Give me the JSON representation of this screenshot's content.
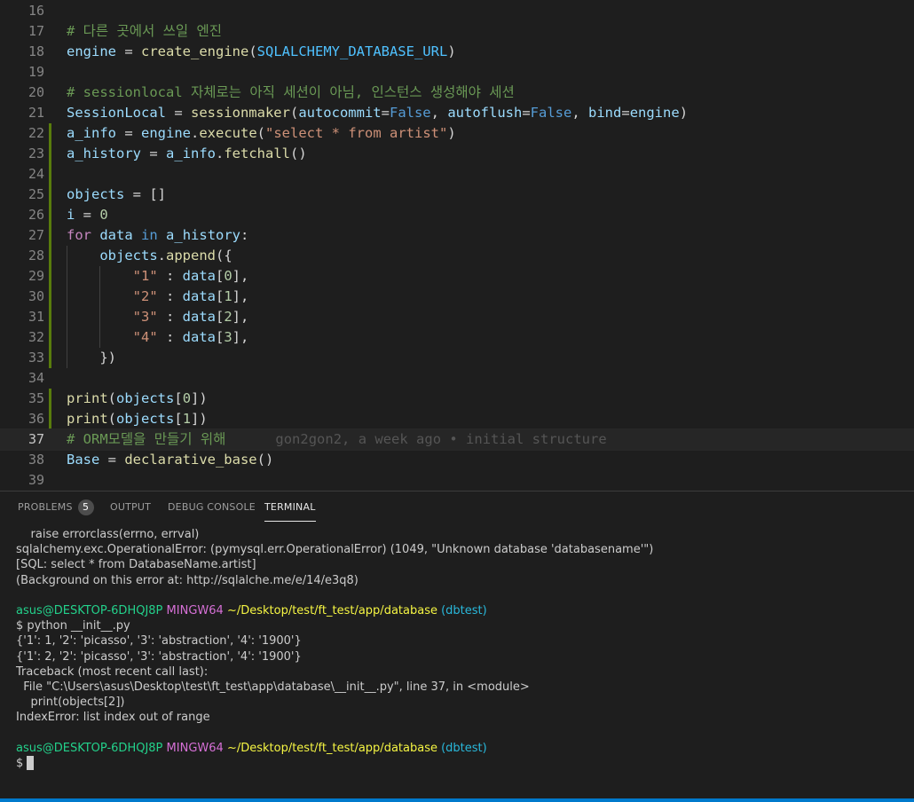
{
  "editor": {
    "lines": [
      {
        "n": "16",
        "tokens": []
      },
      {
        "n": "17",
        "tokens": [
          {
            "t": "# 다른 곳에서 쓰일 엔진",
            "c": "comment"
          }
        ]
      },
      {
        "n": "18",
        "tokens": [
          {
            "t": "engine",
            "c": "var"
          },
          {
            "t": " = ",
            "c": "op"
          },
          {
            "t": "create_engine",
            "c": "fn"
          },
          {
            "t": "(",
            "c": "op"
          },
          {
            "t": "SQLALCHEMY_DATABASE_URL",
            "c": "const"
          },
          {
            "t": ")",
            "c": "op"
          }
        ]
      },
      {
        "n": "19",
        "tokens": []
      },
      {
        "n": "20",
        "tokens": [
          {
            "t": "# sessionlocal 자체로는 아직 세션이 아님, 인스턴스 생성해야 세션",
            "c": "comment"
          }
        ]
      },
      {
        "n": "21",
        "tokens": [
          {
            "t": "SessionLocal",
            "c": "var"
          },
          {
            "t": " = ",
            "c": "op"
          },
          {
            "t": "sessionmaker",
            "c": "fn"
          },
          {
            "t": "(",
            "c": "op"
          },
          {
            "t": "autocommit",
            "c": "var"
          },
          {
            "t": "=",
            "c": "op"
          },
          {
            "t": "False",
            "c": "kw"
          },
          {
            "t": ", ",
            "c": "op"
          },
          {
            "t": "autoflush",
            "c": "var"
          },
          {
            "t": "=",
            "c": "op"
          },
          {
            "t": "False",
            "c": "kw"
          },
          {
            "t": ", ",
            "c": "op"
          },
          {
            "t": "bind",
            "c": "var"
          },
          {
            "t": "=",
            "c": "op"
          },
          {
            "t": "engine",
            "c": "var"
          },
          {
            "t": ")",
            "c": "op"
          }
        ]
      },
      {
        "n": "22",
        "mod": true,
        "tokens": [
          {
            "t": "a_info",
            "c": "var"
          },
          {
            "t": " = ",
            "c": "op"
          },
          {
            "t": "engine",
            "c": "var"
          },
          {
            "t": ".",
            "c": "op"
          },
          {
            "t": "execute",
            "c": "fn"
          },
          {
            "t": "(",
            "c": "op"
          },
          {
            "t": "\"select * from artist\"",
            "c": "str"
          },
          {
            "t": ")",
            "c": "op"
          }
        ]
      },
      {
        "n": "23",
        "mod": true,
        "tokens": [
          {
            "t": "a_history",
            "c": "var"
          },
          {
            "t": " = ",
            "c": "op"
          },
          {
            "t": "a_info",
            "c": "var"
          },
          {
            "t": ".",
            "c": "op"
          },
          {
            "t": "fetchall",
            "c": "fn"
          },
          {
            "t": "()",
            "c": "op"
          }
        ]
      },
      {
        "n": "24",
        "mod": true,
        "tokens": []
      },
      {
        "n": "25",
        "mod": true,
        "tokens": [
          {
            "t": "objects",
            "c": "var"
          },
          {
            "t": " = []",
            "c": "op"
          }
        ]
      },
      {
        "n": "26",
        "mod": true,
        "tokens": [
          {
            "t": "i",
            "c": "var"
          },
          {
            "t": " = ",
            "c": "op"
          },
          {
            "t": "0",
            "c": "num"
          }
        ]
      },
      {
        "n": "27",
        "mod": true,
        "tokens": [
          {
            "t": "for",
            "c": "ctrl"
          },
          {
            "t": " ",
            "c": "op"
          },
          {
            "t": "data",
            "c": "var"
          },
          {
            "t": " ",
            "c": "op"
          },
          {
            "t": "in",
            "c": "kw"
          },
          {
            "t": " ",
            "c": "op"
          },
          {
            "t": "a_history",
            "c": "var"
          },
          {
            "t": ":",
            "c": "op"
          }
        ]
      },
      {
        "n": "28",
        "mod": true,
        "guides": [
          1
        ],
        "tokens": [
          {
            "t": "    ",
            "c": "op"
          },
          {
            "t": "objects",
            "c": "var"
          },
          {
            "t": ".",
            "c": "op"
          },
          {
            "t": "append",
            "c": "fn"
          },
          {
            "t": "({",
            "c": "op"
          }
        ]
      },
      {
        "n": "29",
        "mod": true,
        "guides": [
          1,
          2
        ],
        "tokens": [
          {
            "t": "        ",
            "c": "op"
          },
          {
            "t": "\"1\"",
            "c": "str"
          },
          {
            "t": " : ",
            "c": "op"
          },
          {
            "t": "data",
            "c": "var"
          },
          {
            "t": "[",
            "c": "op"
          },
          {
            "t": "0",
            "c": "num"
          },
          {
            "t": "],",
            "c": "op"
          }
        ]
      },
      {
        "n": "30",
        "mod": true,
        "guides": [
          1,
          2
        ],
        "tokens": [
          {
            "t": "        ",
            "c": "op"
          },
          {
            "t": "\"2\"",
            "c": "str"
          },
          {
            "t": " : ",
            "c": "op"
          },
          {
            "t": "data",
            "c": "var"
          },
          {
            "t": "[",
            "c": "op"
          },
          {
            "t": "1",
            "c": "num"
          },
          {
            "t": "],",
            "c": "op"
          }
        ]
      },
      {
        "n": "31",
        "mod": true,
        "guides": [
          1,
          2
        ],
        "tokens": [
          {
            "t": "        ",
            "c": "op"
          },
          {
            "t": "\"3\"",
            "c": "str"
          },
          {
            "t": " : ",
            "c": "op"
          },
          {
            "t": "data",
            "c": "var"
          },
          {
            "t": "[",
            "c": "op"
          },
          {
            "t": "2",
            "c": "num"
          },
          {
            "t": "],",
            "c": "op"
          }
        ]
      },
      {
        "n": "32",
        "mod": true,
        "guides": [
          1,
          2
        ],
        "tokens": [
          {
            "t": "        ",
            "c": "op"
          },
          {
            "t": "\"4\"",
            "c": "str"
          },
          {
            "t": " : ",
            "c": "op"
          },
          {
            "t": "data",
            "c": "var"
          },
          {
            "t": "[",
            "c": "op"
          },
          {
            "t": "3",
            "c": "num"
          },
          {
            "t": "],",
            "c": "op"
          }
        ]
      },
      {
        "n": "33",
        "mod": true,
        "guides": [
          1
        ],
        "tokens": [
          {
            "t": "    ",
            "c": "op"
          },
          {
            "t": "})",
            "c": "op"
          }
        ]
      },
      {
        "n": "34",
        "tokens": []
      },
      {
        "n": "35",
        "mod": true,
        "tokens": [
          {
            "t": "print",
            "c": "fn"
          },
          {
            "t": "(",
            "c": "op"
          },
          {
            "t": "objects",
            "c": "var"
          },
          {
            "t": "[",
            "c": "op"
          },
          {
            "t": "0",
            "c": "num"
          },
          {
            "t": "])",
            "c": "op"
          }
        ]
      },
      {
        "n": "36",
        "mod": true,
        "tokens": [
          {
            "t": "print",
            "c": "fn"
          },
          {
            "t": "(",
            "c": "op"
          },
          {
            "t": "objects",
            "c": "var"
          },
          {
            "t": "[",
            "c": "op"
          },
          {
            "t": "1",
            "c": "num"
          },
          {
            "t": "])",
            "c": "op"
          }
        ]
      },
      {
        "n": "37",
        "current": true,
        "tokens": [
          {
            "t": "# ORM모델을 만들기 위해",
            "c": "comment"
          },
          {
            "t": "      gon2gon2, a week ago • initial structure",
            "c": "blame"
          }
        ]
      },
      {
        "n": "38",
        "tokens": [
          {
            "t": "Base",
            "c": "var"
          },
          {
            "t": " = ",
            "c": "op"
          },
          {
            "t": "declarative_base",
            "c": "fn"
          },
          {
            "t": "()",
            "c": "op"
          }
        ]
      },
      {
        "n": "39",
        "tokens": []
      }
    ]
  },
  "panel": {
    "tabs": {
      "problems": "PROBLEMS",
      "problems_count": "5",
      "output": "OUTPUT",
      "debug_console": "DEBUG CONSOLE",
      "terminal": "TERMINAL"
    }
  },
  "terminal": {
    "lines": [
      [
        {
          "t": "    raise errorclass(errno, errval)",
          "c": ""
        }
      ],
      [
        {
          "t": "sqlalchemy.exc.OperationalError: (pymysql.err.OperationalError) (1049, \"Unknown database 'databasename'\")",
          "c": ""
        }
      ],
      [
        {
          "t": "[SQL: select * from DatabaseName.artist]",
          "c": ""
        }
      ],
      [
        {
          "t": "(Background on this error at: http://sqlalche.me/e/14/e3q8)",
          "c": ""
        }
      ],
      [],
      [
        {
          "t": "asus@DESKTOP-6DHQJ8P",
          "c": "green"
        },
        {
          "t": " ",
          "c": ""
        },
        {
          "t": "MINGW64",
          "c": "magenta"
        },
        {
          "t": " ",
          "c": ""
        },
        {
          "t": "~/Desktop/test/ft_test/app/database",
          "c": "yellow"
        },
        {
          "t": " ",
          "c": ""
        },
        {
          "t": "(dbtest)",
          "c": "cyan"
        }
      ],
      [
        {
          "t": "$ python __init__.py",
          "c": ""
        }
      ],
      [
        {
          "t": "{'1': 1, '2': 'picasso', '3': 'abstraction', '4': '1900'}",
          "c": ""
        }
      ],
      [
        {
          "t": "{'1': 2, '2': 'picasso', '3': 'abstraction', '4': '1900'}",
          "c": ""
        }
      ],
      [
        {
          "t": "Traceback (most recent call last):",
          "c": ""
        }
      ],
      [
        {
          "t": "  File \"C:\\Users\\asus\\Desktop\\test\\ft_test\\app\\database\\__init__.py\", line 37, in <module>",
          "c": ""
        }
      ],
      [
        {
          "t": "    print(objects[2])",
          "c": ""
        }
      ],
      [
        {
          "t": "IndexError: list index out of range",
          "c": ""
        }
      ],
      [],
      [
        {
          "t": "asus@DESKTOP-6DHQJ8P",
          "c": "green"
        },
        {
          "t": " ",
          "c": ""
        },
        {
          "t": "MINGW64",
          "c": "magenta"
        },
        {
          "t": " ",
          "c": ""
        },
        {
          "t": "~/Desktop/test/ft_test/app/database",
          "c": "yellow"
        },
        {
          "t": " ",
          "c": ""
        },
        {
          "t": "(dbtest)",
          "c": "cyan"
        }
      ],
      [
        {
          "t": "$",
          "c": ""
        }
      ]
    ]
  }
}
